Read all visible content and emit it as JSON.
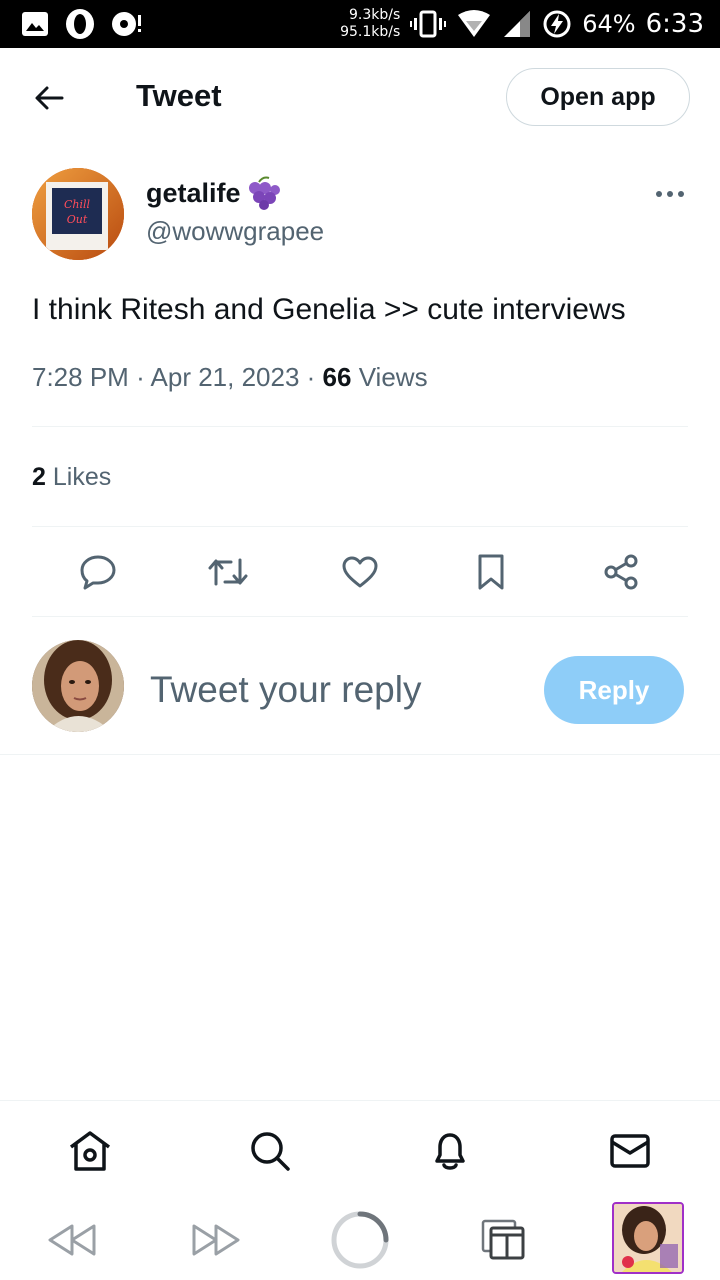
{
  "status_bar": {
    "net_up": "9.3kb/s",
    "net_down": "95.1kb/s",
    "battery": "64%",
    "time": "6:33",
    "icons": [
      "image-icon",
      "opera-icon",
      "record-icon",
      "vibrate-icon",
      "wifi-icon",
      "signal-icon",
      "battery-charging-icon"
    ]
  },
  "header": {
    "title": "Tweet",
    "open_app_label": "Open app",
    "back_icon": "arrow-left-icon"
  },
  "tweet": {
    "display_name": "getalife",
    "handle": "@wowwgrapee",
    "emoji_icon": "grape-icon",
    "text": "I think Ritesh and Genelia >> cute interviews",
    "time": "7:28 PM",
    "date": "Apr 21, 2023",
    "views_count": "66",
    "views_label": "Views",
    "likes_count": "2",
    "likes_label": "Likes",
    "avatar_sign_text": "Chill Out"
  },
  "actions": [
    "reply-icon",
    "retweet-icon",
    "like-icon",
    "bookmark-icon",
    "share-icon"
  ],
  "reply_box": {
    "placeholder": "Tweet your reply",
    "button_label": "Reply"
  },
  "bottom_nav": [
    "home-icon",
    "search-icon",
    "notifications-icon",
    "messages-icon"
  ],
  "browser_bar": [
    "back-arrow-icon",
    "forward-arrow-icon",
    "loading-spinner-icon",
    "tabs-icon",
    "profile-thumbnail"
  ],
  "colors": {
    "accent": "#1d9bf0",
    "reply_button_disabled": "#8ecdf8",
    "secondary_text": "#536471",
    "divider": "#eff3f4"
  }
}
